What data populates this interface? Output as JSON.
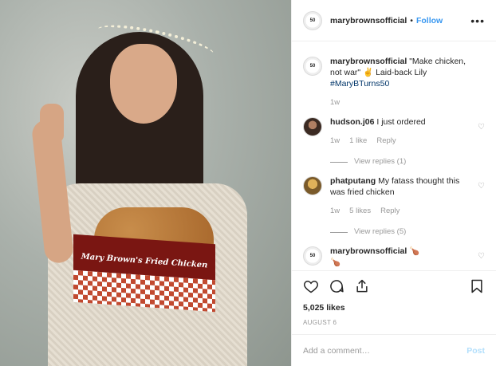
{
  "header": {
    "username": "marybrownsofficial",
    "separator": "•",
    "follow_label": "Follow",
    "more_label": "•••",
    "avatar_text": "50"
  },
  "photo": {
    "box_text": "Mary Brown's Fried Chicken"
  },
  "comments": [
    {
      "username": "marybrownsofficial",
      "text": "\"Make chicken, not war\" ✌ Laid-back Lily",
      "hashtag": "#MaryBTurns50",
      "time": "1w",
      "avatar_text": "50"
    },
    {
      "username": "hudson.j06",
      "text": "I just ordered",
      "time": "1w",
      "likes": "1 like",
      "reply_label": "Reply",
      "view_replies": "View replies (1)"
    },
    {
      "username": "phatputang",
      "text": "My fatass thought this was fried chicken",
      "time": "1w",
      "likes": "5 likes",
      "reply_label": "Reply",
      "view_replies": "View replies (5)"
    },
    {
      "username": "marybrownsofficial",
      "text": "🍗",
      "second_line": "🍗",
      "avatar_text": "50"
    }
  ],
  "actions": {
    "likes": "5,025 likes",
    "date": "AUGUST 6"
  },
  "add_comment": {
    "placeholder": "Add a comment…",
    "post_label": "Post"
  },
  "icons": {
    "like": "heart-icon",
    "comment": "comment-icon",
    "share": "share-icon",
    "save": "bookmark-icon",
    "comment_like": "small-heart-icon"
  },
  "colors": {
    "accent": "#3897f0",
    "link_dark": "#003569",
    "muted": "#999999",
    "post_disabled": "#b2dffc",
    "box_red": "#7a1612"
  }
}
